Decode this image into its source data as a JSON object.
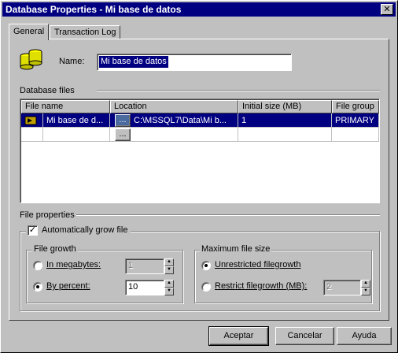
{
  "window": {
    "title": "Database Properties - Mi base de datos",
    "close_glyph": "✕"
  },
  "tabs": [
    {
      "label": "General",
      "active": true
    },
    {
      "label": "Transaction Log",
      "active": false
    }
  ],
  "name_field": {
    "label": "Name:",
    "value": "Mi base de datos"
  },
  "database_files": {
    "section_label": "Database files",
    "columns": [
      "File name",
      "Location",
      "Initial size (MB)",
      "File group"
    ],
    "rows": [
      {
        "file_name": "Mi base de d...",
        "browse": "...",
        "location": "C:\\MSSQL7\\Data\\Mi b...",
        "initial_size": "1",
        "file_group": "PRIMARY",
        "selected": true
      },
      {
        "file_name": "",
        "browse": "...",
        "location": "",
        "initial_size": "",
        "file_group": "",
        "selected": false
      }
    ]
  },
  "file_properties": {
    "section_label": "File properties",
    "auto_grow": {
      "label": "Automatically grow file",
      "checked": true
    },
    "file_growth": {
      "group_label": "File growth",
      "in_megabytes": {
        "label": "In megabytes:",
        "value": "1",
        "selected": false
      },
      "by_percent": {
        "label": "By percent:",
        "value": "10",
        "selected": true
      }
    },
    "max_size": {
      "group_label": "Maximum file size",
      "unrestricted": {
        "label": "Unrestricted filegrowth",
        "selected": true
      },
      "restrict": {
        "label": "Restrict filegrowth (MB):",
        "value": "2",
        "selected": false
      }
    }
  },
  "buttons": {
    "ok": "Aceptar",
    "cancel": "Cancelar",
    "help": "Ayuda"
  },
  "colors": {
    "titlebar": "#000080",
    "selection": "#000080",
    "face": "#c0c0c0"
  }
}
